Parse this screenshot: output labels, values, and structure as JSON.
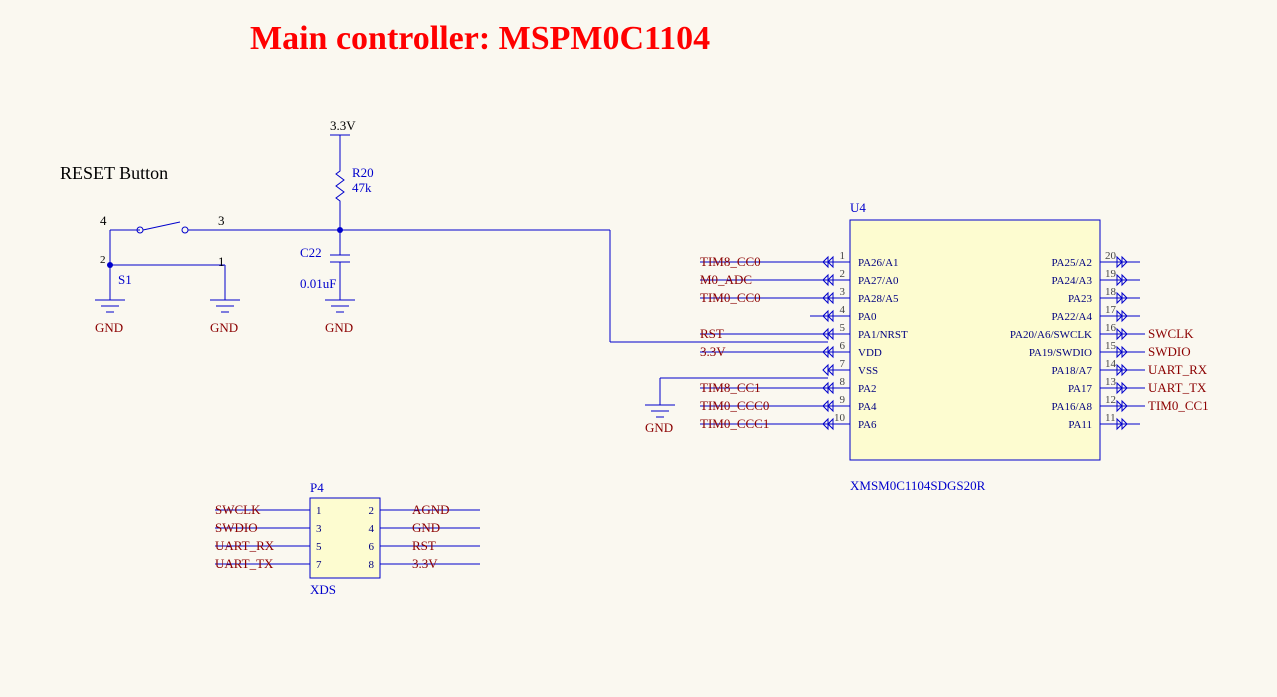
{
  "title": "Main controller: MSPM0C1104",
  "reset_label": "RESET Button",
  "power": {
    "v33": "3.3V"
  },
  "r20": {
    "ref": "R20",
    "val": "47k"
  },
  "c22": {
    "ref": "C22",
    "val": "0.01uF"
  },
  "s1": {
    "ref": "S1",
    "p1": "1",
    "p2": "2",
    "p3": "3",
    "p4": "4"
  },
  "gnd": "GND",
  "u4": {
    "ref": "U4",
    "part": "XMSM0C1104SDGS20R",
    "left": [
      {
        "num": "1",
        "name": "PA26/A1"
      },
      {
        "num": "2",
        "name": "PA27/A0"
      },
      {
        "num": "3",
        "name": "PA28/A5"
      },
      {
        "num": "4",
        "name": "PA0"
      },
      {
        "num": "5",
        "name": "PA1/NRST"
      },
      {
        "num": "6",
        "name": "VDD"
      },
      {
        "num": "7",
        "name": "VSS"
      },
      {
        "num": "8",
        "name": "PA2"
      },
      {
        "num": "9",
        "name": "PA4"
      },
      {
        "num": "10",
        "name": "PA6"
      }
    ],
    "right": [
      {
        "num": "20",
        "name": "PA25/A2"
      },
      {
        "num": "19",
        "name": "PA24/A3"
      },
      {
        "num": "18",
        "name": "PA23"
      },
      {
        "num": "17",
        "name": "PA22/A4"
      },
      {
        "num": "16",
        "name": "PA20/A6/SWCLK"
      },
      {
        "num": "15",
        "name": "PA19/SWDIO"
      },
      {
        "num": "14",
        "name": "PA18/A7"
      },
      {
        "num": "13",
        "name": "PA17"
      },
      {
        "num": "12",
        "name": "PA16/A8"
      },
      {
        "num": "11",
        "name": "PA11"
      }
    ],
    "left_nets": {
      "1": "TIM8_CC0",
      "2": "M0_ADC",
      "3": "TIM0_CC0",
      "5": "RST",
      "6": "3.3V",
      "8": "TIM8_CC1",
      "9": "TIM0_CCC0",
      "10": "TIM0_CCC1"
    },
    "right_nets": {
      "16": "SWCLK",
      "15": "SWDIO",
      "14": "UART_RX",
      "13": "UART_TX",
      "12": "TIM0_CC1"
    }
  },
  "p4": {
    "ref": "P4",
    "part": "XDS",
    "left": [
      {
        "num": "1",
        "net": "SWCLK"
      },
      {
        "num": "3",
        "net": "SWDIO"
      },
      {
        "num": "5",
        "net": "UART_RX"
      },
      {
        "num": "7",
        "net": "UART_TX"
      }
    ],
    "right": [
      {
        "num": "2",
        "net": "AGND"
      },
      {
        "num": "4",
        "net": "GND"
      },
      {
        "num": "6",
        "net": "RST"
      },
      {
        "num": "8",
        "net": "3.3V"
      }
    ]
  }
}
